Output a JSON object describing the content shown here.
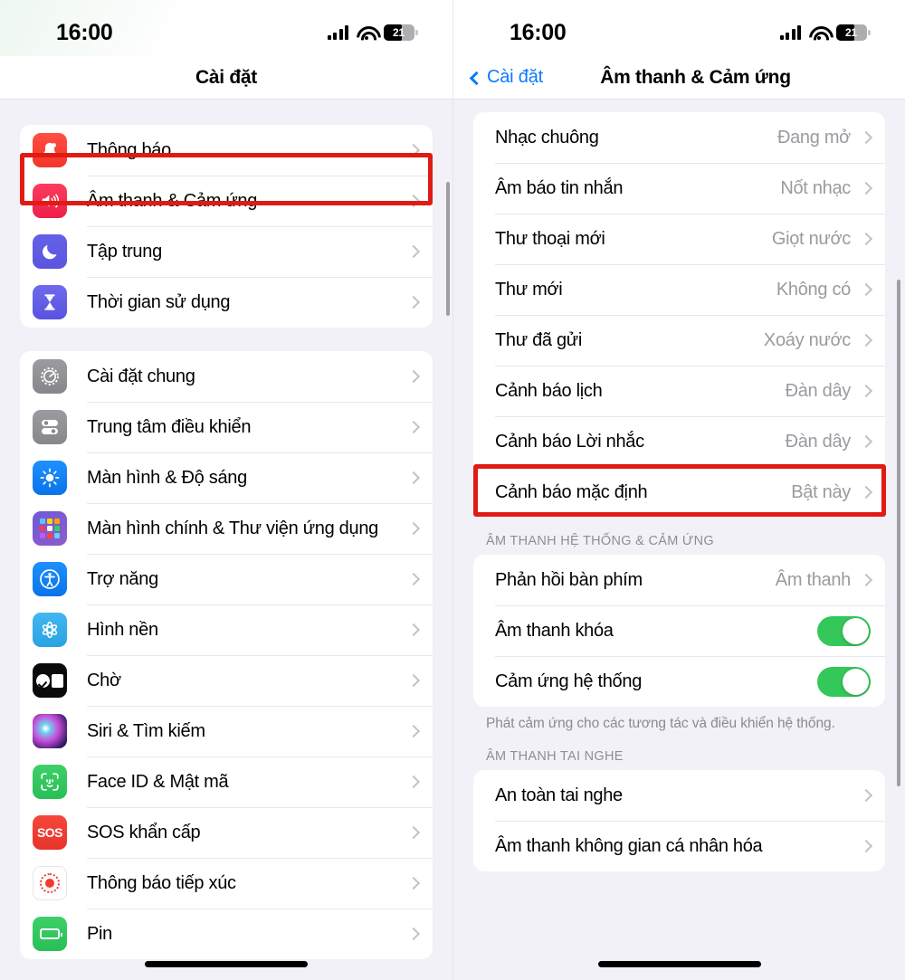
{
  "status": {
    "time": "16:00",
    "battery_percent": "21",
    "signal_icon": "cellular-bars-icon",
    "wifi_icon": "wifi-icon",
    "battery_icon": "battery-icon"
  },
  "left_screen": {
    "nav_title": "Cài đặt",
    "groups": [
      {
        "items": [
          {
            "label": "Thông báo",
            "icon": "bell-icon",
            "icon_class": "ic-bell",
            "glyph": "bell"
          },
          {
            "label": "Âm thanh & Cảm ứng",
            "icon": "speaker-icon",
            "icon_class": "ic-sound",
            "glyph": "sound",
            "highlighted": true
          },
          {
            "label": "Tập trung",
            "icon": "moon-icon",
            "icon_class": "ic-focus",
            "glyph": "moon"
          },
          {
            "label": "Thời gian sử dụng",
            "icon": "hourglass-icon",
            "icon_class": "ic-screentime",
            "glyph": "hourglass"
          }
        ]
      },
      {
        "items": [
          {
            "label": "Cài đặt chung",
            "icon": "gear-icon",
            "icon_class": "ic-general",
            "glyph": "gear"
          },
          {
            "label": "Trung tâm điều khiển",
            "icon": "control-center-icon",
            "icon_class": "ic-control",
            "glyph": "ctrl"
          },
          {
            "label": "Màn hình & Độ sáng",
            "icon": "brightness-icon",
            "icon_class": "ic-display",
            "glyph": "sun"
          },
          {
            "label": "Màn hình chính & Thư viện ứng dụng",
            "icon": "app-grid-icon",
            "icon_class": "ic-home",
            "glyph": "grid"
          },
          {
            "label": "Trợ năng",
            "icon": "accessibility-icon",
            "icon_class": "ic-access",
            "glyph": "person"
          },
          {
            "label": "Hình nền",
            "icon": "wallpaper-icon",
            "icon_class": "ic-wallpaper",
            "glyph": "flower"
          },
          {
            "label": "Chờ",
            "icon": "standby-icon",
            "icon_class": "ic-standby",
            "glyph": "standby"
          },
          {
            "label": "Siri & Tìm kiếm",
            "icon": "siri-icon",
            "icon_class": "ic-siri",
            "glyph": "siri"
          },
          {
            "label": "Face ID & Mật mã",
            "icon": "faceid-icon",
            "icon_class": "ic-faceid",
            "glyph": "face"
          },
          {
            "label": "SOS khẩn cấp",
            "icon": "sos-icon",
            "icon_class": "ic-sos",
            "glyph": "sos"
          },
          {
            "label": "Thông báo tiếp xúc",
            "icon": "exposure-notification-icon",
            "icon_class": "ic-exposure",
            "glyph": "expo"
          },
          {
            "label": "Pin",
            "icon": "battery-icon",
            "icon_class": "ic-battery",
            "glyph": "batt"
          }
        ]
      }
    ]
  },
  "right_screen": {
    "back_label": "Cài đặt",
    "nav_title": "Âm thanh & Cảm ứng",
    "sound_rows": [
      {
        "label": "Nhạc chuông",
        "value": "Đang mở"
      },
      {
        "label": "Âm báo tin nhắn",
        "value": "Nốt nhạc"
      },
      {
        "label": "Thư thoại mới",
        "value": "Giọt nước"
      },
      {
        "label": "Thư mới",
        "value": "Không có"
      },
      {
        "label": "Thư đã gửi",
        "value": "Xoáy nước"
      },
      {
        "label": "Cảnh báo lịch",
        "value": "Đàn dây"
      },
      {
        "label": "Cảnh báo Lời nhắc",
        "value": "Đàn dây"
      },
      {
        "label": "Cảnh báo mặc định",
        "value": "Bật này",
        "highlighted": true
      }
    ],
    "system_section": {
      "header": "ÂM THANH HỆ THỐNG & CẢM ỨNG",
      "rows": [
        {
          "label": "Phản hồi bàn phím",
          "value": "Âm thanh",
          "type": "link"
        },
        {
          "label": "Âm thanh khóa",
          "type": "toggle",
          "on": true
        },
        {
          "label": "Cảm ứng hệ thống",
          "type": "toggle",
          "on": true
        }
      ],
      "footer": "Phát cảm ứng cho các tương tác và điều khiển hệ thống."
    },
    "headphone_section": {
      "header": "ÂM THANH TAI NGHE",
      "rows": [
        {
          "label": "An toàn tai nghe"
        },
        {
          "label": "Âm thanh không gian cá nhân hóa"
        }
      ]
    }
  },
  "colors": {
    "highlight": "#E01B14",
    "accent_blue": "#0A7AFF",
    "toggle_on": "#34C759",
    "page_bg": "#F2F1F7"
  }
}
